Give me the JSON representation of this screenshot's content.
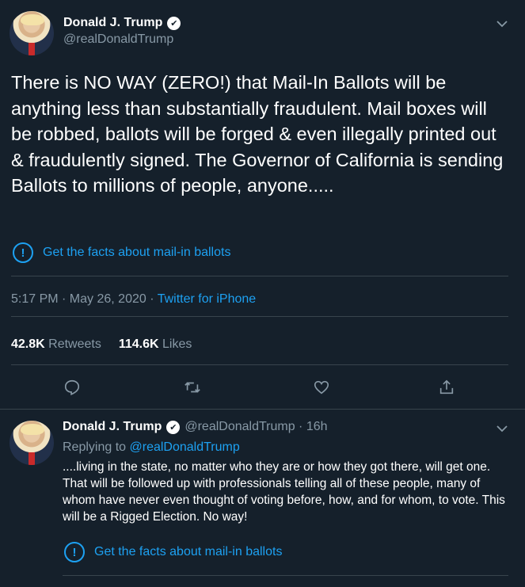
{
  "tweet": {
    "author_name": "Donald J. Trump",
    "handle": "@realDonaldTrump",
    "verified_mark": "✔",
    "text": "There is NO WAY (ZERO!) that Mail-In Ballots will be anything less than substantially fraudulent. Mail boxes will be robbed, ballots will be forged & even illegally printed out & fraudulently signed. The Governor of California is sending Ballots to millions of people, anyone.....",
    "facts_link": "Get the facts about mail-in ballots",
    "time": "5:17 PM · May 26, 2020 · ",
    "source": "Twitter for iPhone",
    "retweets_count": "42.8K",
    "retweets_label": "Retweets",
    "likes_count": "114.6K",
    "likes_label": "Likes",
    "icons": [
      "chevron-down-icon",
      "info-icon",
      "reply-icon",
      "retweet-icon",
      "like-icon",
      "share-icon"
    ]
  },
  "reply": {
    "author_name": "Donald J. Trump",
    "handle_time": "@realDonaldTrump · 16h",
    "replying_prefix": "Replying to ",
    "replying_handle": "@realDonaldTrump",
    "text": "....living in the state, no matter who they are or how they got there, will get one. That will be followed up with professionals telling all of these people, many of whom have never even thought of voting before, how, and for whom, to vote. This will be a Rigged Election. No way!",
    "facts_link": "Get the facts about mail-in ballots"
  },
  "colors": {
    "background": "#15202b",
    "accent": "#1da1f2",
    "muted": "#8899a6",
    "divider": "#38444d"
  }
}
